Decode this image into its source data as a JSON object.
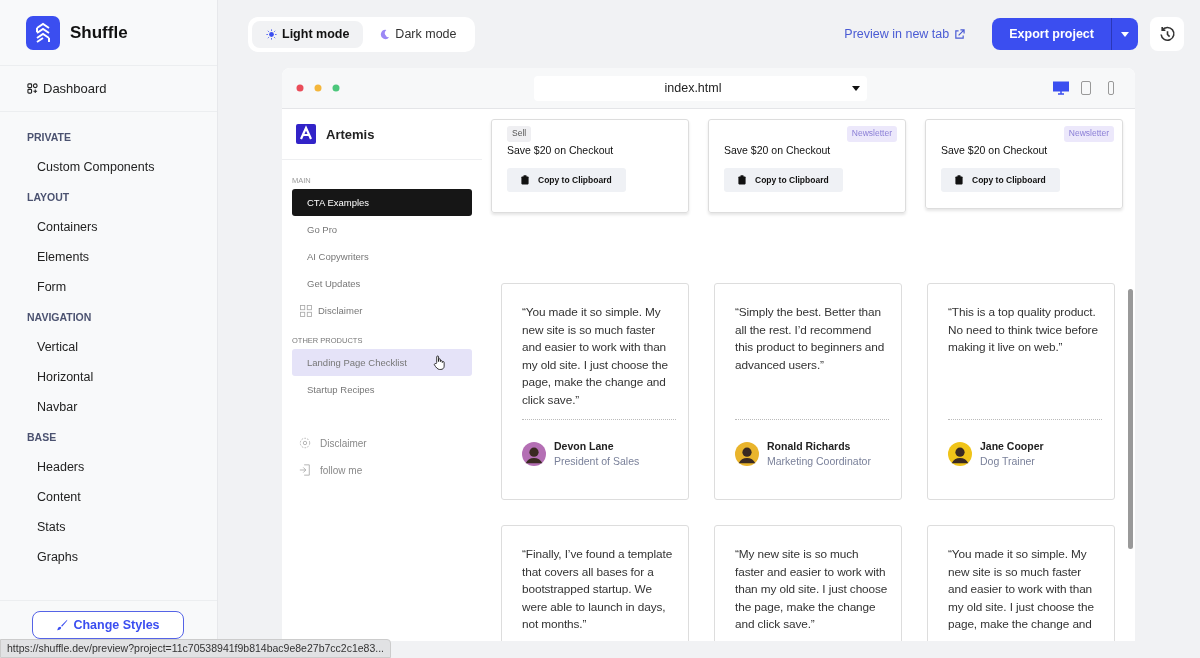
{
  "brand": {
    "name": "Shuffle"
  },
  "sidebar": {
    "dashboard": "Dashboard",
    "sections": [
      {
        "title": "PRIVATE",
        "items": [
          "Custom Components"
        ]
      },
      {
        "title": "LAYOUT",
        "items": [
          "Containers",
          "Elements",
          "Form"
        ]
      },
      {
        "title": "NAVIGATION",
        "items": [
          "Vertical",
          "Horizontal",
          "Navbar"
        ]
      },
      {
        "title": "BASE",
        "items": [
          "Headers",
          "Content",
          "Stats",
          "Graphs"
        ]
      }
    ],
    "change_styles": "Change Styles"
  },
  "mode_toggle": [
    {
      "label": "Light mode",
      "selected": true
    },
    {
      "label": "Dark mode",
      "selected": false
    }
  ],
  "preview_link": "Preview in new tab",
  "export_button": "Export project",
  "preview": {
    "file": "index.html",
    "devices": [
      {
        "kind": "desktop",
        "selected": true
      },
      {
        "kind": "tablet",
        "selected": false
      },
      {
        "kind": "phone",
        "selected": false
      }
    ],
    "site_name": "Artemis",
    "nav_groups": [
      {
        "title": "MAIN",
        "items": [
          {
            "label": "CTA Examples",
            "kind": "text",
            "selected": true,
            "highlighted": false
          },
          {
            "label": "Go Pro",
            "kind": "text",
            "selected": false,
            "highlighted": false
          },
          {
            "label": "AI Copywriters",
            "kind": "text",
            "selected": false,
            "highlighted": false
          },
          {
            "label": "Get Updates",
            "kind": "text",
            "selected": false,
            "highlighted": false
          },
          {
            "label": "Disclaimer",
            "kind": "icon",
            "selected": false,
            "highlighted": false
          }
        ]
      },
      {
        "title": "OTHER PRODUCTS",
        "items": [
          {
            "label": "Landing Page Checklist",
            "kind": "text",
            "selected": false,
            "highlighted": true
          },
          {
            "label": "Startup Recipes",
            "kind": "text",
            "selected": false,
            "highlighted": false
          }
        ]
      }
    ],
    "footer_links": [
      "Disclaimer",
      "follow me"
    ],
    "cta_cards": [
      {
        "tag": {
          "label": "Sell",
          "kind": "neutral"
        },
        "title": "Save $20 on Checkout",
        "button": "Copy to Clipboard"
      },
      {
        "tag": {
          "label": "Newsletter",
          "kind": "accent"
        },
        "title": "Save $20 on Checkout",
        "button": "Copy to Clipboard"
      },
      {
        "tag": {
          "label": "Newsletter",
          "kind": "accent"
        },
        "title": "Save $20 on Checkout",
        "button": "Copy to Clipboard"
      }
    ],
    "testimonials": [
      {
        "quote": "“You made it so simple. My new site is so much faster and easier to work with than my old site. I just choose the page, make the change and click save.”",
        "name": "Devon Lane",
        "role": "President of Sales",
        "color": "#b46fb4"
      },
      {
        "quote": "“Simply the best. Better than all the rest. I’d recommend this product to beginners and advanced users.”",
        "name": "Ronald Richards",
        "role": "Marketing Coordinator",
        "color": "#e9b42c"
      },
      {
        "quote": "“This is a top quality product. No need to think twice before making it live on web.”",
        "name": "Jane Cooper",
        "role": "Dog Trainer",
        "color": "#f0c419"
      },
      {
        "quote": "“Finally, I’ve found a template that covers all bases for a bootstrapped startup. We were able to launch in days, not months.”"
      },
      {
        "quote": "“My new site is so much faster and easier to work with than my old site. I just choose the page, make the change and click save.”"
      },
      {
        "quote": "“You made it so simple. My new site is so much faster and easier to work with than my old site. I just choose the page, make the change and"
      }
    ]
  },
  "status_url": "https://shuffle.dev/preview?project=11c70538941f9b814bac9e8e27b7cc2c1e83..."
}
